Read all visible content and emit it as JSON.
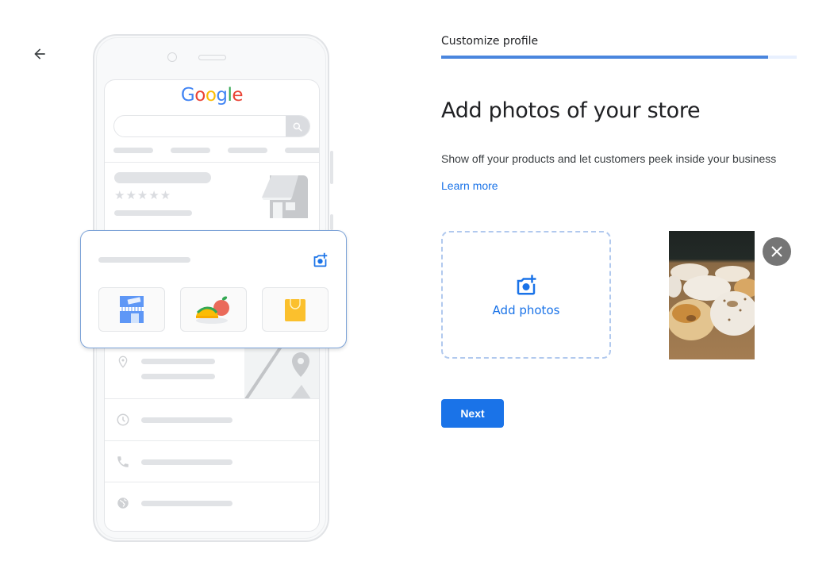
{
  "nav": {
    "back_icon": "arrow-back-icon"
  },
  "header": {
    "step_label": "Customize profile",
    "progress_percent": 92,
    "progress_color": "#4a86de"
  },
  "main": {
    "title": "Add photos of your store",
    "subtitle": "Show off your products and let customers peek inside your business",
    "learn_more": "Learn more",
    "add_photos": {
      "label": "Add photos",
      "icon": "add-photo-camera-icon"
    },
    "uploaded_photo": {
      "description": "Bagels on wooden board",
      "remove_icon": "close-icon"
    },
    "next_button": "Next"
  },
  "illustration": {
    "brand": {
      "letters": [
        "G",
        "o",
        "o",
        "g",
        "l",
        "e"
      ],
      "colors": [
        "#4285f4",
        "#ea4335",
        "#fbbc05",
        "#4285f4",
        "#34a853",
        "#ea4335"
      ]
    },
    "search_icon": "search-icon",
    "rating_stars": 5,
    "card_icon": "add-photo-camera-icon",
    "thumbnails": [
      "storefront-icon",
      "food-icon",
      "shopping-bag-icon"
    ],
    "info_rows": [
      "location-pin-icon",
      "clock-icon",
      "phone-icon",
      "globe-icon"
    ]
  },
  "colors": {
    "accent": "#1a73e8",
    "dashed_border": "#b1c9ee",
    "remove_button": "#757575"
  }
}
